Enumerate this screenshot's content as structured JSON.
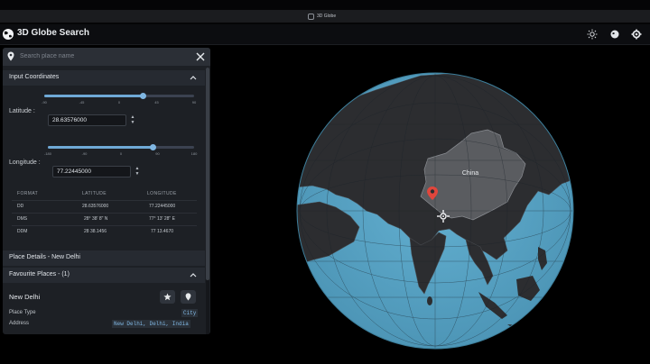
{
  "window": {
    "title": "3D Globe"
  },
  "header": {
    "title": "3D Globe Search",
    "icons": [
      "brightness-icon",
      "globe-mode-icon",
      "settings-icon"
    ]
  },
  "search": {
    "placeholder": "Search place name",
    "value": ""
  },
  "input_coordinates": {
    "title": "Input Coordinates",
    "latitude": {
      "label": "Latitude :",
      "value": "28.63576000",
      "slider_min": -90,
      "slider_max": 90,
      "ticks": [
        "-90",
        "-45",
        "0",
        "45",
        "90"
      ]
    },
    "longitude": {
      "label": "Longitude :",
      "value": "77.22445000",
      "slider_min": -180,
      "slider_max": 180,
      "ticks": [
        "-180",
        "-90",
        "0",
        "90",
        "180"
      ]
    },
    "table": {
      "headers": [
        "FORMAT",
        "LATITUDE",
        "LONGITUDE"
      ],
      "rows": [
        {
          "format": "DD",
          "latitude": "28.63576000",
          "longitude": "77.22445000"
        },
        {
          "format": "DMS",
          "latitude": "28° 38' 8\" N",
          "longitude": "77° 13' 28\" E"
        },
        {
          "format": "DDM",
          "latitude": "28 38.1456",
          "longitude": "77 13.4670"
        }
      ]
    }
  },
  "place_details": {
    "title": "Place Details - New Delhi"
  },
  "favourites": {
    "title": "Favourite Places - (1)",
    "place": {
      "name": "New Delhi",
      "type_label": "Place Type",
      "type_value": "City",
      "address_label": "Address",
      "address_value": "New Delhi, Delhi, India"
    }
  },
  "map": {
    "country_label": "China"
  },
  "colors": {
    "ocean": "#5aa6c7",
    "land": "#2b2c2f",
    "accent": "#6fa9d6",
    "marker": "#e0463c"
  }
}
